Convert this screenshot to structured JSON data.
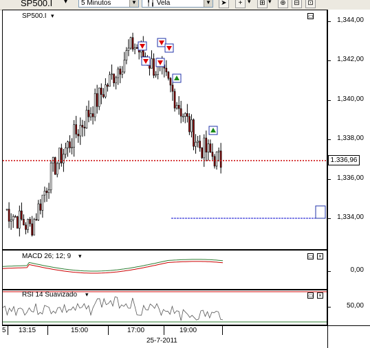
{
  "toolbar": {
    "symbol": "SP500.I",
    "interval": "5 Minutos",
    "chart_style": "Vela",
    "cursor_icon": "pointer-icon",
    "crosshair_icon": "crosshair-icon",
    "tool_icon": "tool-icon"
  },
  "price_panel": {
    "title": "SP500.I",
    "ticks": [
      "1,344,00",
      "1,342,00",
      "1,340,00",
      "1,338,00",
      "1,336,00",
      "1,334,00"
    ],
    "last_price": "1.336,96",
    "ticks_display": [
      "1,344,00",
      "1,342,00",
      "1,340,00",
      "1,338,00",
      "1,336,00",
      "1,334,00"
    ]
  },
  "macd_panel": {
    "title": "MACD 26; 12; 9",
    "tick": "0,00"
  },
  "rsi_panel": {
    "title": "RSI 14 Suavizado",
    "tick": "50,00"
  },
  "time_axis": {
    "labels": [
      "13:15",
      "15:00",
      "17:00",
      "19:00"
    ],
    "date": "25-7-2011",
    "left_fragment": "5"
  },
  "colors": {
    "up_candle": "#ffffff",
    "down_candle": "#8b0000",
    "last_price_line": "#cc0000",
    "macd_line": "#2e7d32",
    "signal_line": "#cc0000",
    "rsi_line": "#555555",
    "rsi_upper": "#cc0000",
    "rsi_lower": "#2e7d32",
    "trend_line": "#0000cc"
  }
}
